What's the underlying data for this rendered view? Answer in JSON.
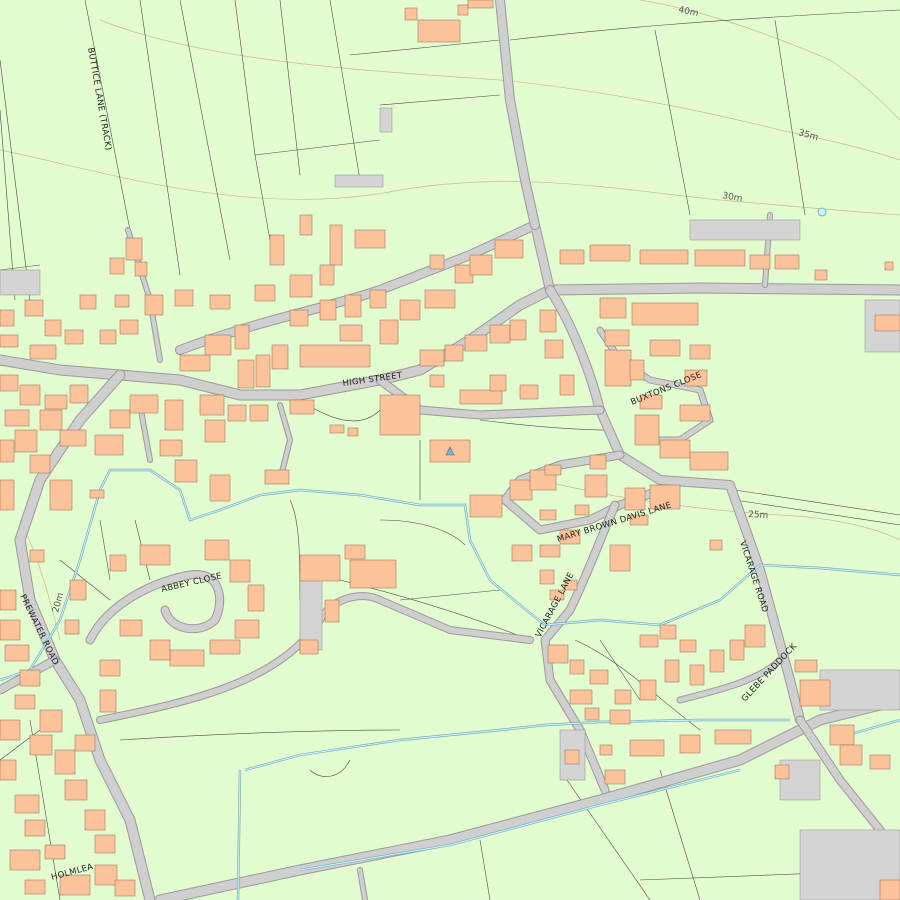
{
  "map": {
    "background": "#e2fbcf",
    "colors": {
      "building": "#fcc39a",
      "road": "#cfcfcf",
      "water": "#6fa4b4",
      "contour": "#c9b98a",
      "parcel_line": "#4a4a4a"
    },
    "street_labels": {
      "high_street": "HIGH STREET",
      "buttice_lane": "BUTTICE LANE (TRACK)",
      "buxtons_close": "BUXTONS CLOSE",
      "mary_brown_davis_lane": "MARY BROWN DAVIS LANE",
      "vicarage_road": "VICARAGE ROAD",
      "vicarage_lane": "VICARAGE LANE",
      "abbey_close": "ABBEY CLOSE",
      "prewater_road": "PREWATER ROAD",
      "glebe_paddock": "GLEBE PADDOCK",
      "holmlea": "HOLMLEA"
    },
    "contour_labels": {
      "c40": "40m",
      "c35": "35m",
      "c30": "30m",
      "c25": "25m",
      "c20": "20m"
    },
    "icons": {
      "church_marker": "triangle-icon"
    }
  }
}
